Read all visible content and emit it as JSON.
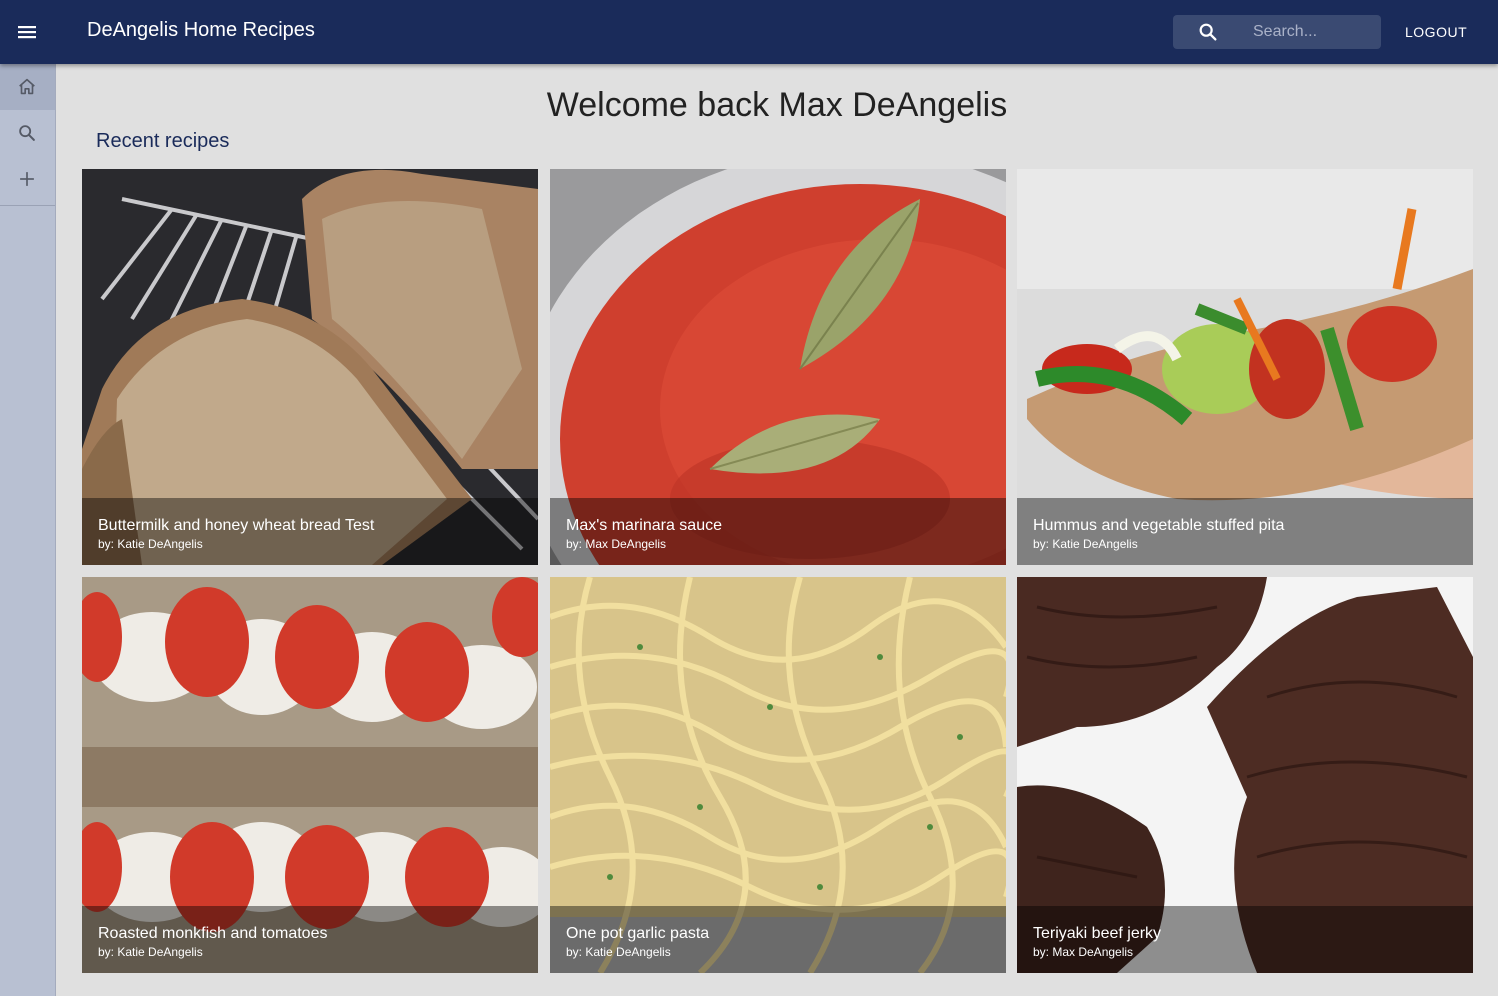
{
  "app": {
    "title": "DeAngelis Home Recipes"
  },
  "header": {
    "search_placeholder": "Search...",
    "logout_label": "LOGOUT"
  },
  "sidebar": {
    "items": [
      {
        "icon": "home-icon",
        "active": true
      },
      {
        "icon": "search-icon",
        "active": false
      },
      {
        "icon": "add-icon",
        "active": false
      }
    ]
  },
  "main": {
    "welcome": "Welcome back Max DeAngelis",
    "section_title": "Recent recipes",
    "recipes": [
      {
        "title": "Buttermilk and honey wheat bread Test",
        "author": "by: Katie DeAngelis"
      },
      {
        "title": "Max's marinara sauce",
        "author": "by: Max DeAngelis"
      },
      {
        "title": "Hummus and vegetable stuffed pita",
        "author": "by: Katie DeAngelis"
      },
      {
        "title": "Roasted monkfish and tomatoes",
        "author": "by: Katie DeAngelis"
      },
      {
        "title": "One pot garlic pasta",
        "author": "by: Katie DeAngelis"
      },
      {
        "title": "Teriyaki beef jerky",
        "author": "by: Max DeAngelis"
      }
    ]
  },
  "colors": {
    "appbar": "#1a2b5a",
    "sidebar": "#b8c0d2",
    "background": "#e0e0e0"
  }
}
